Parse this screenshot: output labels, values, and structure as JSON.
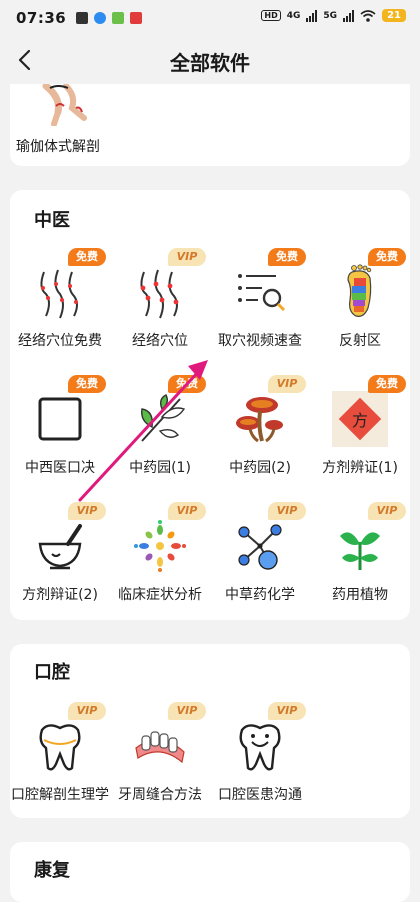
{
  "status_bar": {
    "time": "07:36",
    "hd": "HD",
    "net1": "4G",
    "net2": "5G",
    "battery": "21"
  },
  "header": {
    "title": "全部软件"
  },
  "yoga_card": {
    "item_label": "瑜伽体式解剖"
  },
  "tcm": {
    "title": "中医",
    "items": [
      {
        "label": "经络穴位免费",
        "badge": "免费"
      },
      {
        "label": "经络穴位",
        "badge": "VIP"
      },
      {
        "label": "取穴视频速查",
        "badge": "免费"
      },
      {
        "label": "反射区",
        "badge": "免费"
      },
      {
        "label": "中西医口决",
        "badge": "免费"
      },
      {
        "label": "中药园(1)",
        "badge": "免费"
      },
      {
        "label": "中药园(2)",
        "badge": "VIP"
      },
      {
        "label": "方剂辨证(1)",
        "badge": "免费",
        "glyph": "方"
      },
      {
        "label": "方剂辩证(2)",
        "badge": "VIP"
      },
      {
        "label": "临床症状分析",
        "badge": "VIP"
      },
      {
        "label": "中草药化学",
        "badge": "VIP"
      },
      {
        "label": "药用植物",
        "badge": "VIP"
      }
    ]
  },
  "dental": {
    "title": "口腔",
    "items": [
      {
        "label": "口腔解剖生理学",
        "badge": "VIP"
      },
      {
        "label": "牙周缝合方法",
        "badge": "VIP"
      },
      {
        "label": "口腔医患沟通",
        "badge": "VIP"
      }
    ]
  },
  "rehab": {
    "title": "康复"
  },
  "colors": {
    "accent": "#f47b1a",
    "vip_bg": "#f7e3b3",
    "annotation": "#e0197d"
  }
}
